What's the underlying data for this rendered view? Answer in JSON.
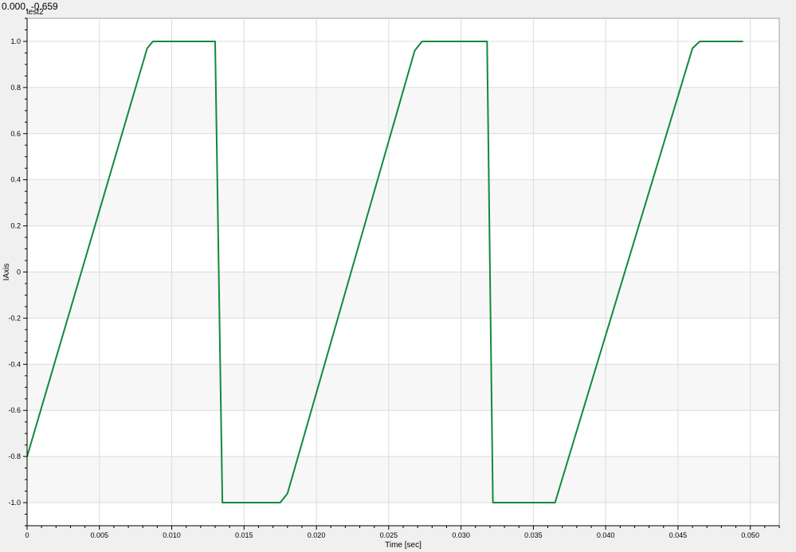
{
  "coord_readout": "0.000, -0.659",
  "chart_data": {
    "type": "line",
    "title": "test2",
    "xlabel": "Time [sec]",
    "ylabel": "IAxis",
    "xlim": [
      0,
      0.052
    ],
    "ylim": [
      -1.1,
      1.1
    ],
    "x_ticks": [
      0,
      0.005,
      0.01,
      0.015,
      0.02,
      0.025,
      0.03,
      0.035,
      0.04,
      0.045,
      0.05
    ],
    "x_tick_labels": [
      "0",
      "0.005",
      "0.010",
      "0.015",
      "0.020",
      "0.025",
      "0.030",
      "0.035",
      "0.040",
      "0.045",
      "0.050"
    ],
    "y_ticks": [
      -1.0,
      -0.8,
      -0.6,
      -0.4,
      -0.2,
      0,
      0.2,
      0.4,
      0.6,
      0.8,
      1.0
    ],
    "y_tick_labels": [
      "-1.0",
      "-0.8",
      "-0.6",
      "-0.4",
      "-0.2",
      "0",
      "0.2",
      "0.4",
      "0.6",
      "0.8",
      "1.0"
    ],
    "grid": true,
    "series": [
      {
        "color": "#108a3c",
        "x": [
          0.0,
          0.0083,
          0.0087,
          0.013,
          0.0135,
          0.0175,
          0.018,
          0.0268,
          0.0273,
          0.0318,
          0.0322,
          0.0365,
          0.046,
          0.0465,
          0.0495
        ],
        "y": [
          -0.8,
          0.97,
          1.0,
          1.0,
          -1.0,
          -1.0,
          -0.96,
          0.96,
          1.0,
          1.0,
          -1.0,
          -1.0,
          0.97,
          1.0,
          1.0
        ]
      }
    ]
  }
}
